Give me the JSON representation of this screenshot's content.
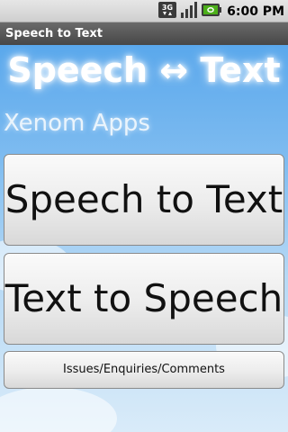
{
  "status_bar": {
    "network_label": "3G",
    "time": "6:00 PM"
  },
  "title_bar": {
    "title": "Speech to Text"
  },
  "banner": {
    "title": "Speech ↔ Text",
    "subtitle": "Xenom Apps"
  },
  "buttons": {
    "speech_to_text": "Speech to Text",
    "text_to_speech": "Text to Speech",
    "issues": "Issues/Enquiries/Comments"
  },
  "colors": {
    "sky_top": "#5aa8ec",
    "sky_bottom": "#d9ebf9",
    "title_bar": "#555555",
    "battery": "#4caf1a"
  },
  "icons": [
    "3g-icon",
    "signal-icon",
    "battery-icon"
  ]
}
